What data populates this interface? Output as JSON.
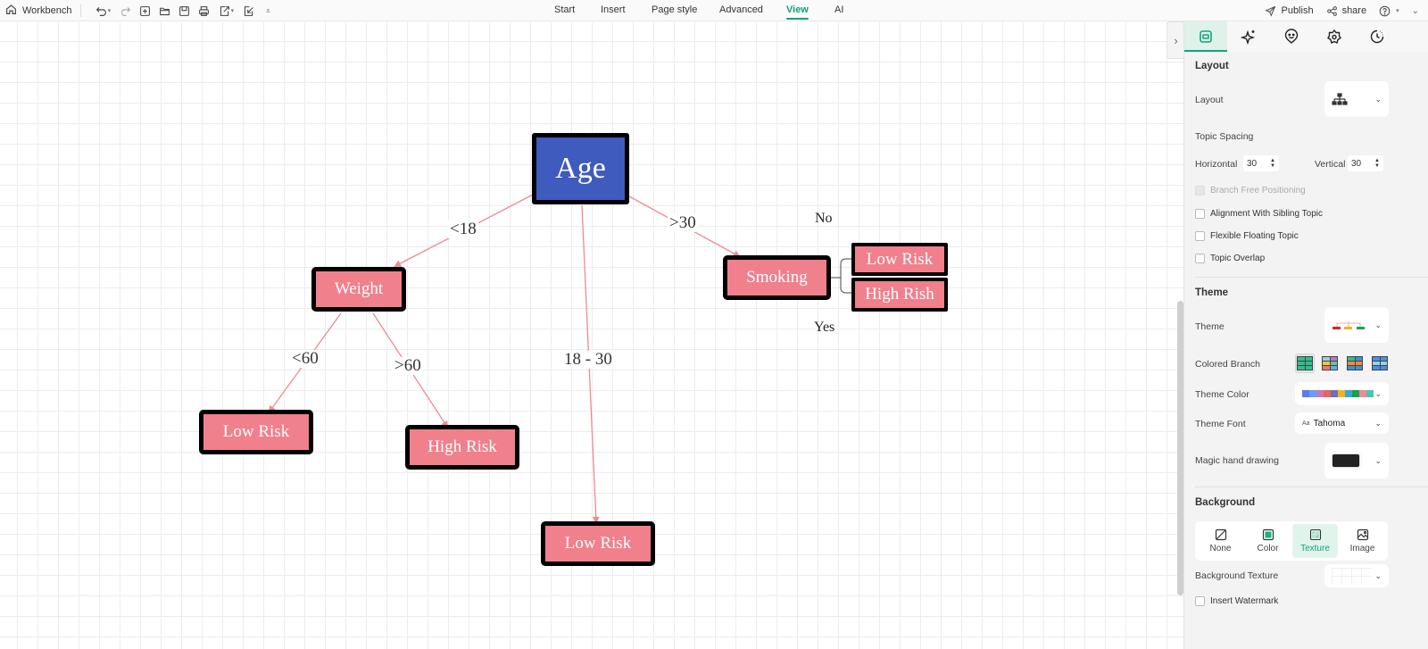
{
  "toolbar": {
    "home_label": "Workbench",
    "home_icon": "home-icon",
    "icons": [
      "undo-icon",
      "redo-icon",
      "add-page-icon",
      "open-folder-icon",
      "save-icon",
      "print-icon",
      "export-icon",
      "import-icon",
      "more-icon"
    ],
    "tabs": [
      {
        "label": "Start",
        "active": false
      },
      {
        "label": "Insert",
        "active": false
      },
      {
        "label": "Page style",
        "active": false
      },
      {
        "label": "Advanced",
        "active": false
      },
      {
        "label": "View",
        "active": true
      },
      {
        "label": "AI",
        "active": false
      }
    ],
    "publish_label": "Publish",
    "share_label": "share",
    "help_icon": "help-icon",
    "accent_color": "#10a37f"
  },
  "diagram": {
    "root": {
      "label": "Age",
      "color": "#3f5bbd"
    },
    "node_color": "#f0808c",
    "edge_color": "#ee8a94",
    "nodes": {
      "weight": "Weight",
      "smoking": "Smoking",
      "weight_low": "Low Risk",
      "weight_high": "High Risk",
      "mid_low": "Low Risk",
      "smoking_low": "Low Risk",
      "smoking_high": "High Rish"
    },
    "edge_labels": {
      "lt18": "<18",
      "r18_30": "18 - 30",
      "gt30": ">30",
      "lt60": "<60",
      "gt60": ">60"
    },
    "side_labels": {
      "no": "No",
      "yes": "Yes"
    }
  },
  "panel": {
    "tabs": [
      {
        "icon": "layout-icon",
        "active": true
      },
      {
        "icon": "ai-sparkle-icon",
        "active": false
      },
      {
        "icon": "smiley-icon",
        "active": false
      },
      {
        "icon": "badge-icon",
        "active": false
      },
      {
        "icon": "history-clock-icon",
        "active": false
      }
    ],
    "layout": {
      "title": "Layout",
      "layout_label": "Layout",
      "topic_spacing_label": "Topic Spacing",
      "horizontal_label": "Horizontal",
      "horizontal_value": "30",
      "vertical_label": "Vertical",
      "vertical_value": "30",
      "checkboxes": [
        {
          "label": "Branch Free Positioning",
          "checked": false,
          "disabled": true
        },
        {
          "label": "Alignment With Sibling Topic",
          "checked": false,
          "disabled": false
        },
        {
          "label": "Flexible Floating Topic",
          "checked": false,
          "disabled": false
        },
        {
          "label": "Topic Overlap",
          "checked": false,
          "disabled": false
        }
      ]
    },
    "theme": {
      "title": "Theme",
      "theme_label": "Theme",
      "colored_branch_label": "Colored Branch",
      "theme_color_label": "Theme Color",
      "theme_color_swatches": [
        "#5b7cf0",
        "#6f9af5",
        "#c879b8",
        "#e9645c",
        "#6c6fbd",
        "#f4b21c",
        "#3aa8c9",
        "#14a44d",
        "#ee8a94",
        "#49c6b4"
      ],
      "theme_font_label": "Theme Font",
      "theme_font_value": "Tahoma",
      "theme_font_prefix": "Aa",
      "magic_label": "Magic hand drawing",
      "magic_color": "#222222"
    },
    "background": {
      "title": "Background",
      "options": [
        {
          "label": "None",
          "icon": "none-slash-icon",
          "selected": false
        },
        {
          "label": "Color",
          "icon": "color-fill-icon",
          "selected": false
        },
        {
          "label": "Texture",
          "icon": "texture-icon",
          "selected": true
        },
        {
          "label": "Image",
          "icon": "image-icon",
          "selected": false
        }
      ],
      "texture_label": "Background Texture",
      "watermark_label": "Insert Watermark",
      "watermark_checked": false
    }
  }
}
